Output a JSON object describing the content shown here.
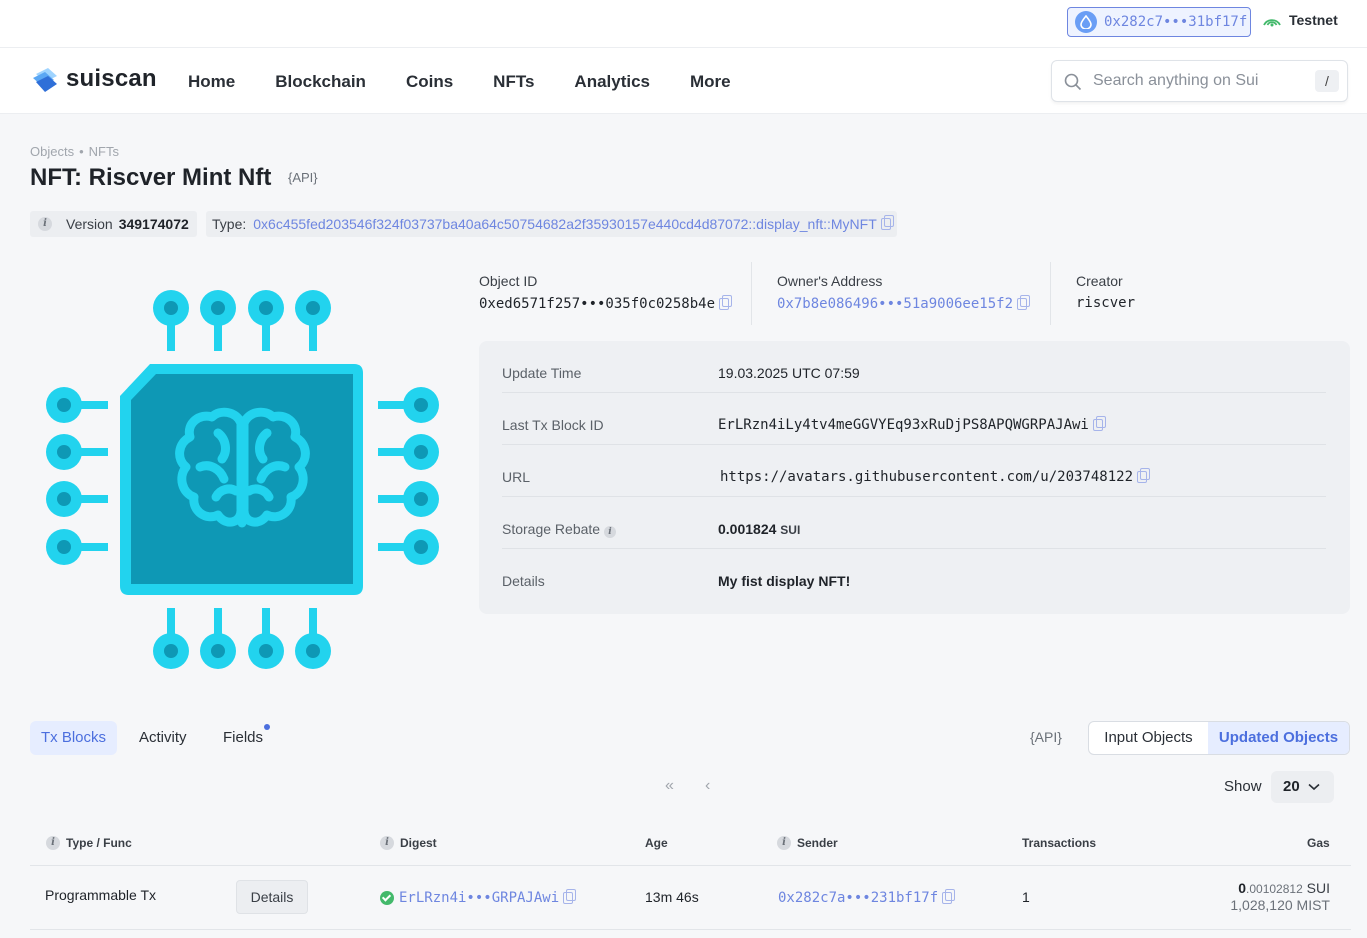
{
  "topbar": {
    "wallet_address": "0x282c7•••31bf17f",
    "network": "Testnet"
  },
  "nav": {
    "logo_text": "suiscan",
    "menu": [
      "Home",
      "Blockchain",
      "Coins",
      "NFTs",
      "Analytics",
      "More"
    ],
    "search_placeholder": "Search anything on Sui",
    "search_shortcut": "/"
  },
  "breadcrumb": [
    "Objects",
    "NFTs"
  ],
  "page": {
    "title": "NFT: Riscver Mint Nft",
    "api_label": "{API}",
    "version_label": "Version",
    "version_value": "349174072",
    "type_label": "Type:",
    "type_value": "0x6c455fed203546f324f03737ba40a64c50754682a2f35930157e440cd4d87072::display_nft::MyNFT"
  },
  "image": {
    "icon": "brain-chip-icon",
    "color_main": "#22d3ee",
    "color_dark": "#0e98b5"
  },
  "summary": {
    "object_id_label": "Object ID",
    "object_id": "0xed6571f257•••035f0c0258b4e",
    "owner_label": "Owner's Address",
    "owner": "0x7b8e086496•••51a9006ee15f2",
    "creator_label": "Creator",
    "creator": "riscver"
  },
  "details": [
    {
      "label": "Update Time",
      "value": "19.03.2025 UTC 07:59"
    },
    {
      "label": "Last Tx Block ID",
      "value": "ErLRzn4iLy4tv4meGGVYEq93xRuDjPS8APQWGRPAJAwi"
    },
    {
      "label": "URL",
      "value": "https://avatars.githubusercontent.com/u/203748122"
    },
    {
      "label": "Storage Rebate",
      "value": "0.001824",
      "unit": "SUI"
    },
    {
      "label": "Details",
      "value": "My fist display NFT!"
    }
  ],
  "tabs": {
    "items": [
      "Tx Blocks",
      "Activity",
      "Fields"
    ],
    "api_label": "{API}",
    "seg_input": "Input Objects",
    "seg_updated": "Updated Objects"
  },
  "pagination": {
    "first": "«",
    "prev": "‹",
    "show_label": "Show",
    "page_size": "20"
  },
  "table": {
    "headers": [
      "Type / Func",
      "Digest",
      "Age",
      "Sender",
      "Transactions",
      "Gas"
    ],
    "rows": [
      {
        "type": "Programmable Tx",
        "details_btn": "Details",
        "digest": "ErLRzn4i•••GRPAJAwi",
        "age": "13m 46s",
        "sender": "0x282c7a•••231bf17f",
        "transactions": "1",
        "gas_int": "0",
        "gas_frac": ".00102812",
        "gas_unit": "SUI",
        "gas_mist": "1,028,120 MIST"
      }
    ]
  },
  "colors": {
    "accent": "#4c6fde",
    "link": "#6e86e0",
    "success": "#43b96b"
  }
}
